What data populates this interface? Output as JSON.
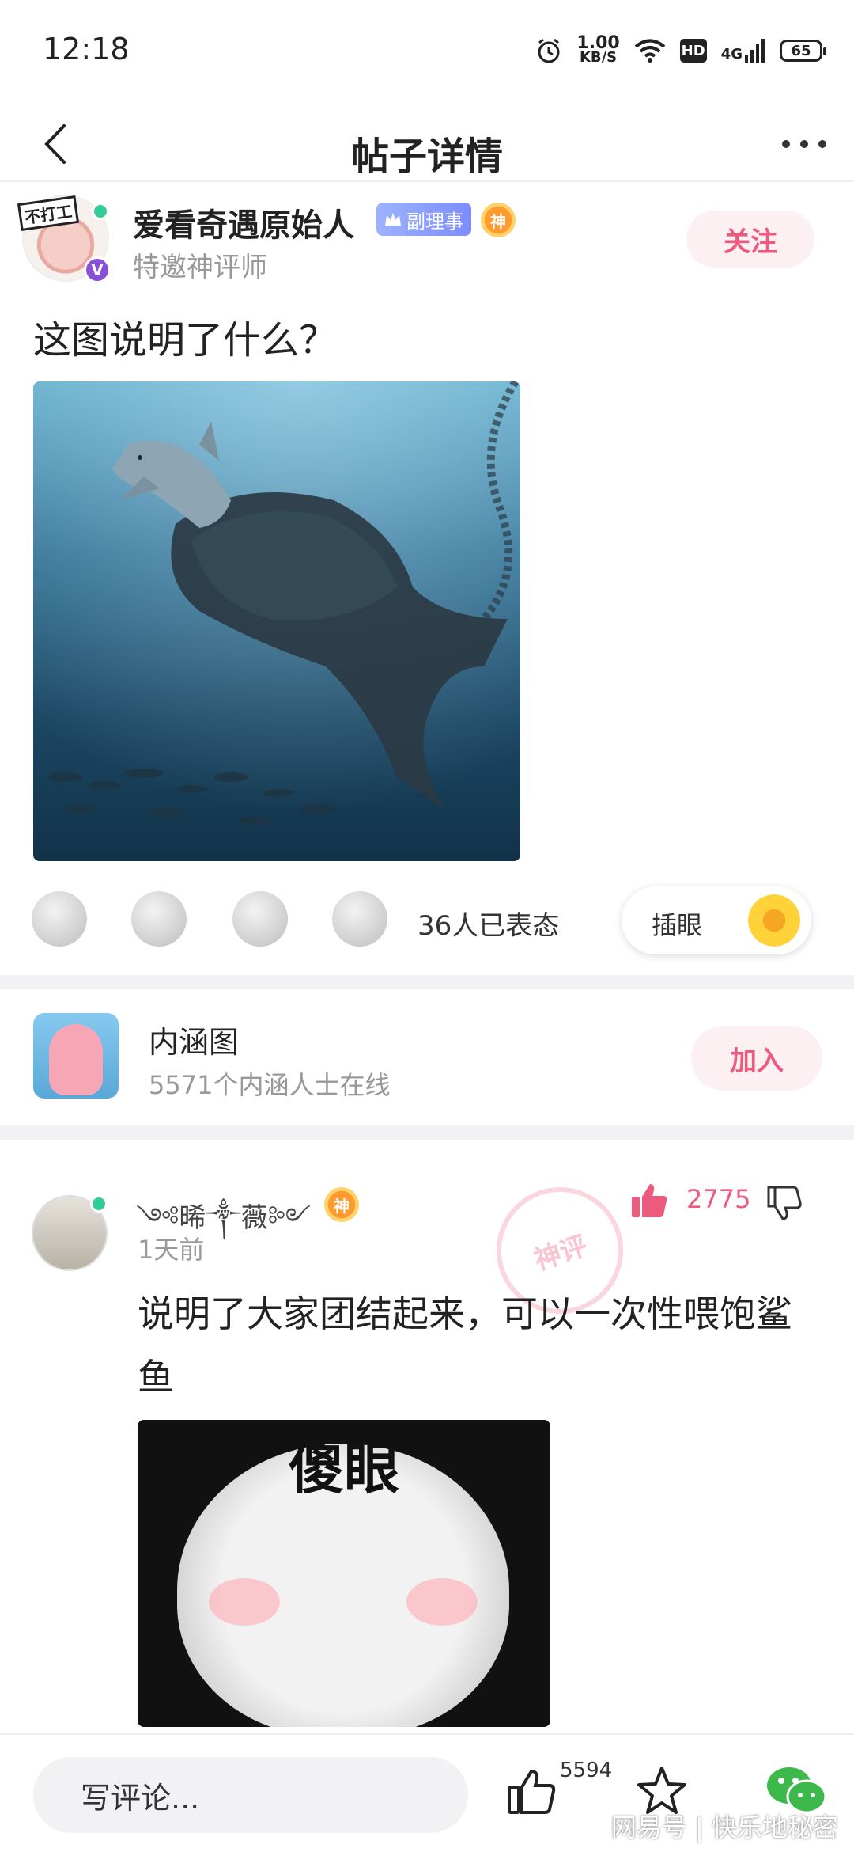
{
  "status_bar": {
    "time": "12:18",
    "net_speed_value": "1.00",
    "net_speed_unit": "KB/S",
    "hd_label": "HD",
    "network": "4G",
    "battery": "65"
  },
  "navbar": {
    "title": "帖子详情"
  },
  "post": {
    "author": {
      "name": "爱看奇遇原始人",
      "rank_badge": "副理事",
      "god_badge": "神",
      "subtitle": "特邀神评师",
      "avatar_tag": "不打工",
      "verified_badge": "V"
    },
    "follow_label": "关注",
    "text": "这图说明了什么？",
    "reactions": {
      "count_text": "36人已表态",
      "chayan_label": "插眼"
    }
  },
  "group": {
    "name": "内涵图",
    "subtitle": "5571个内涵人士在线",
    "join_label": "加入"
  },
  "comment": {
    "author": "༺晞༒薇༻",
    "god_badge": "神",
    "time": "1天前",
    "like_count": "2775",
    "stamp": "神评",
    "text": "说明了大家团结起来，可以一次性喂饱鲨鱼",
    "meme_caption": "傻眼"
  },
  "bottom_bar": {
    "input_placeholder": "写评论...",
    "like_count": "5594",
    "watermark": "网易号 | 快乐地秘密"
  },
  "colors": {
    "accent_pink": "#ec5a7e",
    "online_green": "#33cc99"
  }
}
